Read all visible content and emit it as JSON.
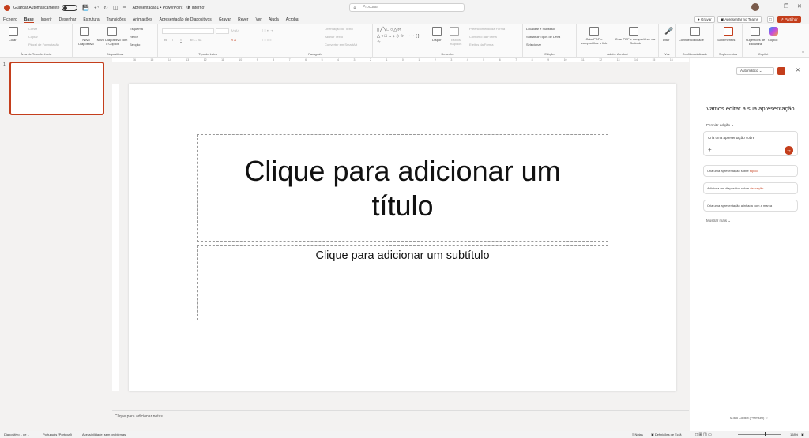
{
  "titlebar": {
    "autosave_label": "Guardar Automaticamente",
    "title": "Apresentação1 • PowerPoint",
    "sensitivity": "Interno*",
    "search_placeholder": "Procurar"
  },
  "menubar": {
    "items": [
      "Ficheiro",
      "Base",
      "Inserir",
      "Desenhar",
      "Estrutura",
      "Transições",
      "Animações",
      "Apresentação de Diapositivos",
      "Gravar",
      "Rever",
      "Ver",
      "Ajuda",
      "Acrobat"
    ],
    "active": "Base",
    "record_btn": "Gravar",
    "present_btn": "Apresentar no Teams",
    "share_btn": "Partilhar"
  },
  "ribbon": {
    "clipboard": {
      "label": "Área de Transferência",
      "paste": "Colar",
      "cut": "Cortar",
      "copy": "Copiar",
      "format_painter": "Pincel de Formatação"
    },
    "slides": {
      "label": "Diapositivos",
      "new": "Novo Diapositivo",
      "new_copilot": "Novo Diapositivo com o Copilot",
      "layout": "Esquema",
      "reset": "Repor",
      "section": "Secção"
    },
    "font": {
      "label": "Tipo de Letra",
      "bold": "N",
      "italic": "I",
      "underline": "S"
    },
    "paragraph": {
      "label": "Parágrafo",
      "direction": "Orientação do Texto",
      "align": "Alinhar Texto",
      "smartart": "Converter em SmartArt"
    },
    "drawing": {
      "label": "Desenho",
      "arrange": "Dispor",
      "styles": "Estilos Rápidos",
      "fill": "Preenchimento da Forma",
      "outline": "Contorno da Forma",
      "effects": "Efeitos da Forma"
    },
    "editing": {
      "label": "Edição",
      "find": "Localizar e Substituir",
      "replace_fonts": "Substituir Tipos de Letra",
      "select": "Selecionar"
    },
    "acrobat": {
      "label": "Adobe Acrobat",
      "create_pdf": "Criar PDF e compartilhar o link",
      "create_pdf_outlook": "Criar PDF e compartilhar via Outlook"
    },
    "voice": {
      "label": "Voz",
      "dictate": "Ditar"
    },
    "sensitivity": {
      "label": "Confidencialidade",
      "btn": "Confidencialidade"
    },
    "addins": {
      "label": "Suplementos",
      "btn": "Suplementos"
    },
    "copilot": {
      "label": "Copilot",
      "designer": "Sugestões de Estrutura",
      "copilot": "Copilot"
    }
  },
  "ruler": {
    "ticks": [
      "16",
      "15",
      "14",
      "13",
      "12",
      "11",
      "10",
      "9",
      "8",
      "7",
      "6",
      "5",
      "4",
      "3",
      "2",
      "1",
      "0",
      "1",
      "2",
      "3",
      "4",
      "5",
      "6",
      "7",
      "8",
      "9",
      "10",
      "11",
      "12",
      "13",
      "14",
      "15",
      "16"
    ]
  },
  "slides_pane": {
    "slide_number": "1"
  },
  "slide": {
    "title_placeholder": "Clique para adicionar um título",
    "subtitle_placeholder": "Clique para adicionar um subtítulo"
  },
  "notes": {
    "placeholder": "Clique para adicionar notas"
  },
  "status": {
    "slide_count": "Diapositivo 1 de 1",
    "language": "Português (Portugal)",
    "accessibility": "Acessibilidade: sem problemas",
    "notes": "Notas",
    "display_settings": "Definições de Ecrã",
    "zoom": "158%"
  },
  "copilot_pane": {
    "mode": "Automático",
    "heading": "Vamos editar a sua apresentação",
    "permission": "Permitir edição",
    "input_placeholder": "Cria uma apresentação sobre",
    "suggestions": [
      {
        "text": "Cria uma apresentação sobre ",
        "highlight": "tópico"
      },
      {
        "text": "Adiciona um diapositivo sobre ",
        "highlight": "descrição"
      },
      {
        "text": "Cria uma apresentação alinhada com a marca",
        "highlight": ""
      }
    ],
    "show_more": "Mostrar mais",
    "footer": "M365 Copilot (Premium)"
  },
  "colors": {
    "accent": "#c43e1c"
  }
}
